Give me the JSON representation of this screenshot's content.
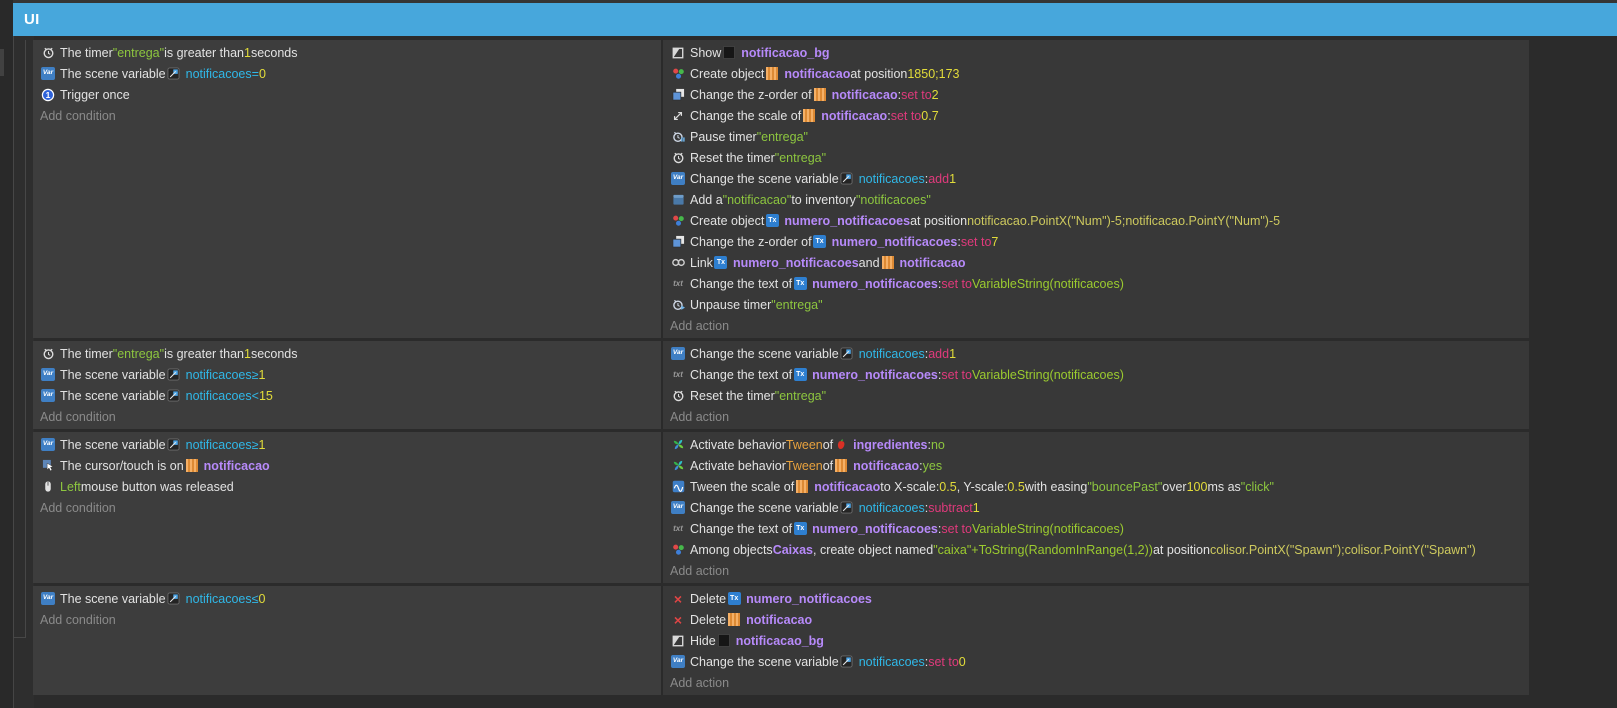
{
  "tab": {
    "title": "UI"
  },
  "labels": {
    "add_condition": "Add condition",
    "add_action": "Add action"
  },
  "colors": {
    "tab_blue": "#47A7DC",
    "event_conditions_bg": "#3D3D3D",
    "event_actions_bg": "#383838",
    "background": "#2B2B2B",
    "text": "#E2E2E2",
    "string_green": "#8DC63F",
    "variable_cyan": "#30B8E8",
    "number_yellow": "#E2DC3A",
    "expression_khaki": "#CDC95E",
    "string_expression_green": "#9BCB2F",
    "operator_pink": "#E03A7C",
    "object_purple": "#B78AFA",
    "behavior_orange": "#E8A23E",
    "muted": "#8A8A8A"
  },
  "events": [
    {
      "conditions": [
        {
          "parts": [
            {
              "ic": "timer-icon"
            },
            {
              "t": "The timer ",
              "c": "w"
            },
            {
              "t": "\"entrega\"",
              "c": "g"
            },
            {
              "t": " is greater than ",
              "c": "w"
            },
            {
              "t": "1",
              "c": "y"
            },
            {
              "t": " seconds",
              "c": "w"
            }
          ]
        },
        {
          "parts": [
            {
              "ic": "variable-icon"
            },
            {
              "t": "The scene variable ",
              "c": "w"
            },
            {
              "ic": "variable-type-icon"
            },
            {
              "t": "notificacoes",
              "c": "c"
            },
            {
              "t": "  =  ",
              "c": "c"
            },
            {
              "t": "0",
              "c": "y"
            }
          ]
        },
        {
          "parts": [
            {
              "ic": "trigger-once-icon"
            },
            {
              "t": "Trigger once",
              "c": "w"
            }
          ]
        }
      ],
      "actions": [
        {
          "parts": [
            {
              "ic": "visibility-icon"
            },
            {
              "t": "Show ",
              "c": "w"
            },
            {
              "ic": "object-notificacao-bg-icon"
            },
            {
              "t": "notificacao_bg",
              "c": "o"
            }
          ]
        },
        {
          "parts": [
            {
              "ic": "create-object-icon"
            },
            {
              "t": "Create object ",
              "c": "w"
            },
            {
              "ic": "object-notificacao-icon"
            },
            {
              "t": "notificacao",
              "c": "o"
            },
            {
              "t": " at position ",
              "c": "w"
            },
            {
              "t": "1850;173",
              "c": "y"
            }
          ]
        },
        {
          "parts": [
            {
              "ic": "z-order-icon"
            },
            {
              "t": "Change the z-order of ",
              "c": "w"
            },
            {
              "ic": "object-notificacao-icon"
            },
            {
              "t": "notificacao",
              "c": "o"
            },
            {
              "t": ": ",
              "c": "w"
            },
            {
              "t": "set to ",
              "c": "p"
            },
            {
              "t": "2",
              "c": "y"
            }
          ]
        },
        {
          "parts": [
            {
              "ic": "scale-icon"
            },
            {
              "t": "Change the scale of ",
              "c": "w"
            },
            {
              "ic": "object-notificacao-icon"
            },
            {
              "t": "notificacao",
              "c": "o"
            },
            {
              "t": ": ",
              "c": "w"
            },
            {
              "t": "set to ",
              "c": "p"
            },
            {
              "t": "0.7",
              "c": "y"
            }
          ]
        },
        {
          "parts": [
            {
              "ic": "pause-timer-icon"
            },
            {
              "t": "Pause timer ",
              "c": "w"
            },
            {
              "t": "\"entrega\"",
              "c": "g"
            }
          ]
        },
        {
          "parts": [
            {
              "ic": "timer-icon"
            },
            {
              "t": "Reset the timer ",
              "c": "w"
            },
            {
              "t": "\"entrega\"",
              "c": "g"
            }
          ]
        },
        {
          "parts": [
            {
              "ic": "variable-icon"
            },
            {
              "t": "Change the scene variable ",
              "c": "w"
            },
            {
              "ic": "variable-type-icon"
            },
            {
              "t": "notificacoes",
              "c": "c"
            },
            {
              "t": ": ",
              "c": "w"
            },
            {
              "t": "add ",
              "c": "p"
            },
            {
              "t": "1",
              "c": "y"
            }
          ]
        },
        {
          "parts": [
            {
              "ic": "inventory-icon"
            },
            {
              "t": "Add a ",
              "c": "w"
            },
            {
              "t": "\"notificacao\"",
              "c": "g"
            },
            {
              "t": " to inventory ",
              "c": "w"
            },
            {
              "t": "\"notificacoes\"",
              "c": "g"
            }
          ]
        },
        {
          "parts": [
            {
              "ic": "create-object-icon"
            },
            {
              "t": "Create object ",
              "c": "w"
            },
            {
              "ic": "object-text-icon"
            },
            {
              "t": "numero_notificacoes",
              "c": "o"
            },
            {
              "t": " at position ",
              "c": "w"
            },
            {
              "t": "notificacao.PointX(\"Num\")-5;notificacao.PointY(\"Num\")-5",
              "c": "k"
            }
          ]
        },
        {
          "parts": [
            {
              "ic": "z-order-icon"
            },
            {
              "t": "Change the z-order of ",
              "c": "w"
            },
            {
              "ic": "object-text-icon"
            },
            {
              "t": "numero_notificacoes",
              "c": "o"
            },
            {
              "t": ": ",
              "c": "w"
            },
            {
              "t": "set to ",
              "c": "p"
            },
            {
              "t": "7",
              "c": "y"
            }
          ]
        },
        {
          "parts": [
            {
              "ic": "link-icon"
            },
            {
              "t": "Link ",
              "c": "w"
            },
            {
              "ic": "object-text-icon"
            },
            {
              "t": "numero_notificacoes",
              "c": "o"
            },
            {
              "t": " and ",
              "c": "w"
            },
            {
              "ic": "object-notificacao-icon"
            },
            {
              "t": "notificacao",
              "c": "o"
            }
          ]
        },
        {
          "parts": [
            {
              "ic": "text-icon"
            },
            {
              "t": "Change the text of ",
              "c": "w"
            },
            {
              "ic": "object-text-icon"
            },
            {
              "t": "numero_notificacoes",
              "c": "o"
            },
            {
              "t": ": ",
              "c": "w"
            },
            {
              "t": "set to ",
              "c": "p"
            },
            {
              "t": "VariableString(notificacoes)",
              "c": "gs"
            }
          ]
        },
        {
          "parts": [
            {
              "ic": "unpause-timer-icon"
            },
            {
              "t": "Unpause timer ",
              "c": "w"
            },
            {
              "t": "\"entrega\"",
              "c": "g"
            }
          ]
        }
      ]
    },
    {
      "conditions": [
        {
          "parts": [
            {
              "ic": "timer-icon"
            },
            {
              "t": "The timer ",
              "c": "w"
            },
            {
              "t": "\"entrega\"",
              "c": "g"
            },
            {
              "t": " is greater than ",
              "c": "w"
            },
            {
              "t": "1",
              "c": "y"
            },
            {
              "t": " seconds",
              "c": "w"
            }
          ]
        },
        {
          "parts": [
            {
              "ic": "variable-icon"
            },
            {
              "t": "The scene variable ",
              "c": "w"
            },
            {
              "ic": "variable-type-icon"
            },
            {
              "t": "notificacoes",
              "c": "c"
            },
            {
              "t": "  ≥  ",
              "c": "c"
            },
            {
              "t": "1",
              "c": "y"
            }
          ]
        },
        {
          "parts": [
            {
              "ic": "variable-icon"
            },
            {
              "t": "The scene variable ",
              "c": "w"
            },
            {
              "ic": "variable-type-icon"
            },
            {
              "t": "notificacoes",
              "c": "c"
            },
            {
              "t": "  <  ",
              "c": "c"
            },
            {
              "t": "15",
              "c": "y"
            }
          ]
        }
      ],
      "actions": [
        {
          "parts": [
            {
              "ic": "variable-icon"
            },
            {
              "t": "Change the scene variable ",
              "c": "w"
            },
            {
              "ic": "variable-type-icon"
            },
            {
              "t": "notificacoes",
              "c": "c"
            },
            {
              "t": ": ",
              "c": "w"
            },
            {
              "t": "add ",
              "c": "p"
            },
            {
              "t": "1",
              "c": "y"
            }
          ]
        },
        {
          "parts": [
            {
              "ic": "text-icon"
            },
            {
              "t": "Change the text of ",
              "c": "w"
            },
            {
              "ic": "object-text-icon"
            },
            {
              "t": "numero_notificacoes",
              "c": "o"
            },
            {
              "t": ": ",
              "c": "w"
            },
            {
              "t": "set to ",
              "c": "p"
            },
            {
              "t": "VariableString(notificacoes)",
              "c": "gs"
            }
          ]
        },
        {
          "parts": [
            {
              "ic": "timer-icon"
            },
            {
              "t": "Reset the timer ",
              "c": "w"
            },
            {
              "t": "\"entrega\"",
              "c": "g"
            }
          ]
        }
      ]
    },
    {
      "conditions": [
        {
          "parts": [
            {
              "ic": "variable-icon"
            },
            {
              "t": "The scene variable ",
              "c": "w"
            },
            {
              "ic": "variable-type-icon"
            },
            {
              "t": "notificacoes",
              "c": "c"
            },
            {
              "t": "  ≥  ",
              "c": "c"
            },
            {
              "t": "1",
              "c": "y"
            }
          ]
        },
        {
          "parts": [
            {
              "ic": "cursor-icon"
            },
            {
              "t": "The cursor/touch is on ",
              "c": "w"
            },
            {
              "ic": "object-notificacao-icon"
            },
            {
              "t": "notificacao",
              "c": "o"
            }
          ]
        },
        {
          "parts": [
            {
              "ic": "mouse-icon"
            },
            {
              "t": "Left",
              "c": "g"
            },
            {
              "t": " mouse button was released",
              "c": "w"
            }
          ]
        }
      ],
      "actions": [
        {
          "parts": [
            {
              "ic": "behavior-icon"
            },
            {
              "t": "Activate behavior ",
              "c": "w"
            },
            {
              "t": "Tween",
              "c": "b"
            },
            {
              "t": " of ",
              "c": "w"
            },
            {
              "ic": "object-ingredientes-icon"
            },
            {
              "t": "ingredientes",
              "c": "o"
            },
            {
              "t": ": ",
              "c": "w"
            },
            {
              "t": "no",
              "c": "g"
            }
          ]
        },
        {
          "parts": [
            {
              "ic": "behavior-icon"
            },
            {
              "t": "Activate behavior ",
              "c": "w"
            },
            {
              "t": "Tween",
              "c": "b"
            },
            {
              "t": " of ",
              "c": "w"
            },
            {
              "ic": "object-notificacao-icon"
            },
            {
              "t": "notificacao",
              "c": "o"
            },
            {
              "t": ": ",
              "c": "w"
            },
            {
              "t": "yes",
              "c": "g"
            }
          ]
        },
        {
          "parts": [
            {
              "ic": "tween-icon"
            },
            {
              "t": "Tween the scale of ",
              "c": "w"
            },
            {
              "ic": "object-notificacao-icon"
            },
            {
              "t": "notificacao",
              "c": "o"
            },
            {
              "t": " to X-scale: ",
              "c": "w"
            },
            {
              "t": "0.5",
              "c": "y"
            },
            {
              "t": ", Y-scale: ",
              "c": "w"
            },
            {
              "t": "0.5",
              "c": "y"
            },
            {
              "t": " with easing ",
              "c": "w"
            },
            {
              "t": "\"bouncePast\"",
              "c": "g"
            },
            {
              "t": " over ",
              "c": "w"
            },
            {
              "t": "100",
              "c": "y"
            },
            {
              "t": "ms as ",
              "c": "w"
            },
            {
              "t": "\"click\"",
              "c": "g"
            }
          ]
        },
        {
          "parts": [
            {
              "ic": "variable-icon"
            },
            {
              "t": "Change the scene variable ",
              "c": "w"
            },
            {
              "ic": "variable-type-icon"
            },
            {
              "t": "notificacoes",
              "c": "c"
            },
            {
              "t": ": ",
              "c": "w"
            },
            {
              "t": "subtract ",
              "c": "p"
            },
            {
              "t": "1",
              "c": "y"
            }
          ]
        },
        {
          "parts": [
            {
              "ic": "text-icon"
            },
            {
              "t": "Change the text of ",
              "c": "w"
            },
            {
              "ic": "object-text-icon"
            },
            {
              "t": "numero_notificacoes",
              "c": "o"
            },
            {
              "t": ": ",
              "c": "w"
            },
            {
              "t": "set to ",
              "c": "p"
            },
            {
              "t": "VariableString(notificacoes)",
              "c": "gs"
            }
          ]
        },
        {
          "parts": [
            {
              "ic": "create-object-icon"
            },
            {
              "t": "Among objects ",
              "c": "w"
            },
            {
              "t": "Caixas",
              "c": "o"
            },
            {
              "t": ", create object named ",
              "c": "w"
            },
            {
              "t": "\"caixa\"+ToString(RandomInRange(1,2))",
              "c": "gs"
            },
            {
              "t": " at position ",
              "c": "w"
            },
            {
              "t": "colisor.PointX(\"Spawn\");colisor.PointY(\"Spawn\")",
              "c": "k"
            }
          ]
        }
      ]
    },
    {
      "conditions": [
        {
          "parts": [
            {
              "ic": "variable-icon"
            },
            {
              "t": "The scene variable ",
              "c": "w"
            },
            {
              "ic": "variable-type-icon"
            },
            {
              "t": "notificacoes",
              "c": "c"
            },
            {
              "t": "  ≤  ",
              "c": "c"
            },
            {
              "t": "0",
              "c": "y"
            }
          ]
        }
      ],
      "actions": [
        {
          "parts": [
            {
              "ic": "delete-icon"
            },
            {
              "t": "Delete ",
              "c": "w"
            },
            {
              "ic": "object-text-icon"
            },
            {
              "t": "numero_notificacoes",
              "c": "o"
            }
          ]
        },
        {
          "parts": [
            {
              "ic": "delete-icon"
            },
            {
              "t": "Delete ",
              "c": "w"
            },
            {
              "ic": "object-notificacao-icon"
            },
            {
              "t": "notificacao",
              "c": "o"
            }
          ]
        },
        {
          "parts": [
            {
              "ic": "visibility-icon"
            },
            {
              "t": "Hide ",
              "c": "w"
            },
            {
              "ic": "object-notificacao-bg-icon"
            },
            {
              "t": "notificacao_bg",
              "c": "o"
            }
          ]
        },
        {
          "parts": [
            {
              "ic": "variable-icon"
            },
            {
              "t": "Change the scene variable ",
              "c": "w"
            },
            {
              "ic": "variable-type-icon"
            },
            {
              "t": "notificacoes",
              "c": "c"
            },
            {
              "t": ": ",
              "c": "w"
            },
            {
              "t": "set to ",
              "c": "p"
            },
            {
              "t": "0",
              "c": "y"
            }
          ]
        }
      ]
    }
  ]
}
